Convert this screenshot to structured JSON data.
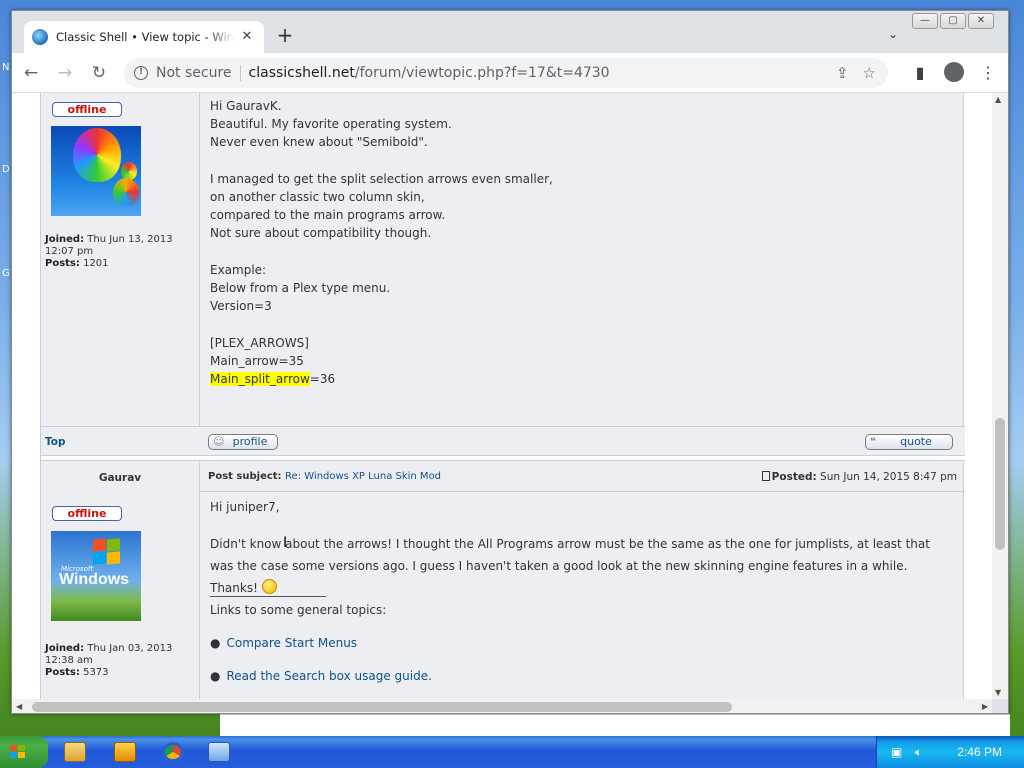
{
  "desktop": {
    "edge_labels": [
      "N",
      "D",
      "G"
    ]
  },
  "browser": {
    "tab_title": "Classic Shell • View topic - Windows XP Luna Skin Mod",
    "tab_close": "✕",
    "new_tab": "+",
    "tab_search": "⌄",
    "window_buttons": {
      "minimize": "—",
      "maximize": "▢",
      "close": "✕"
    },
    "nav": {
      "back": "←",
      "forward": "→",
      "reload": "↻"
    },
    "security_label": "Not secure",
    "url_host": "classicshell.net",
    "url_path": "/forum/viewtopic.php?f=17&t=4730",
    "omni_icons": {
      "share": "⇪",
      "bookmark": "☆"
    },
    "toolbar_icons": {
      "sidepanel": "▮",
      "menu": "⋮"
    }
  },
  "post1": {
    "status": "offline",
    "joined_label": "Joined:",
    "joined_value": "Thu Jun 13, 2013 12:07 pm",
    "posts_label": "Posts:",
    "posts_value": "1201",
    "body_before_highlight": "Hi GauravK.\nBeautiful. My favorite operating system.\nNever even knew about \"Semibold\".\n\nI managed to get the split selection arrows even smaller,\non another classic two column skin,\ncompared to the main programs arrow.\nNot sure about compatibility though.\n\nExample:\nBelow from a Plex type menu.\nVersion=3\n\n[PLEX_ARROWS]\nMain_arrow=35\n",
    "highlight": "Main_split_arrow",
    "body_after_highlight": "=36",
    "top_link": "Top",
    "profile_btn": "profile",
    "quote_btn": "quote"
  },
  "post2": {
    "author": "Gaurav",
    "subject_label": "Post subject:",
    "subject_value": "Re: Windows XP Luna Skin Mod",
    "posted_label": "Posted:",
    "posted_value": "Sun Jun 14, 2015 8:47 pm",
    "status": "offline",
    "avatar_brand": "Microsoft",
    "avatar_word": "Windows",
    "joined_label": "Joined:",
    "joined_value": "Thu Jan 03, 2013 12:38 am",
    "posts_label": "Posts:",
    "posts_value": "5373",
    "greeting": "Hi juniper7,",
    "paragraph": "Didn't know about the arrows! I thought the All Programs arrow must be the same as the one for jumplists, at least that was the case some versions ago. I guess I haven't taken a good look at the new skinning engine features in a while. Thanks!",
    "links_heading": "Links to some general topics:",
    "links": [
      "Compare Start Menus",
      "Read the Search box usage guide."
    ]
  },
  "taskbar": {
    "clock": "2:46 PM"
  }
}
